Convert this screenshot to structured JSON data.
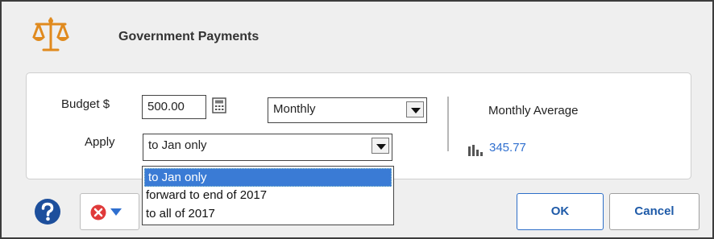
{
  "dialog": {
    "title": "Government Payments"
  },
  "budget": {
    "label": "Budget $",
    "value": "500.00"
  },
  "frequency": {
    "selected": "Monthly"
  },
  "apply": {
    "label": "Apply",
    "selected": "to Jan only",
    "options": [
      "to Jan only",
      "forward to end of 2017",
      "to all of 2017"
    ]
  },
  "average": {
    "label": "Monthly Average",
    "value": "345.77"
  },
  "buttons": {
    "ok": "OK",
    "cancel": "Cancel"
  },
  "icons": {
    "title": "scales-icon",
    "calculator": "calculator-icon",
    "chart": "bar-chart-icon",
    "help": "help-icon",
    "error": "error-icon",
    "caret": "chevron-down-icon"
  },
  "colors": {
    "accent": "#2f6fcf",
    "selection": "#3a7bd5",
    "icon_orange": "#e08a1e",
    "error_red": "#e03a3a"
  }
}
